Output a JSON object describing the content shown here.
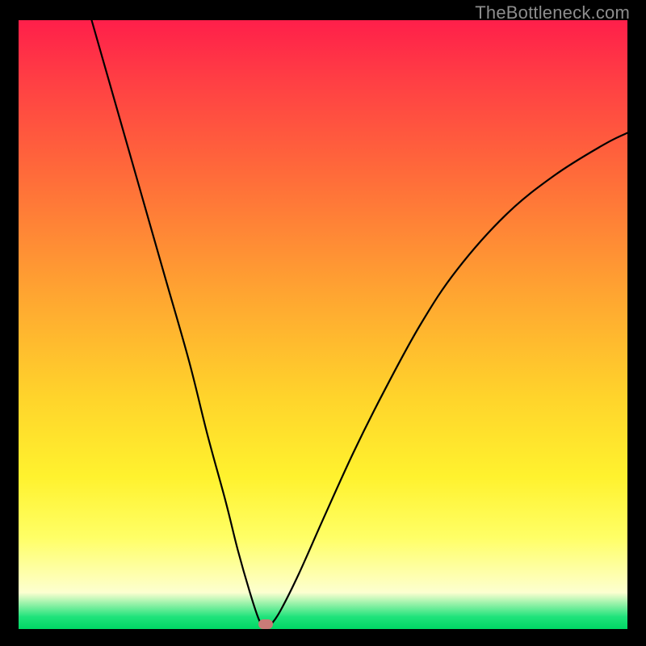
{
  "watermark": "TheBottleneck.com",
  "gradient_colors": {
    "top": "#ff1f4a",
    "mid_upper": "#ff8a36",
    "mid": "#ffe92f",
    "pale": "#fdffd0",
    "bottom": "#00d864"
  },
  "marker": {
    "x_pct": 40.6,
    "y_pct": 99.2,
    "color": "#c97b77"
  },
  "chart_data": {
    "type": "line",
    "title": "",
    "xlabel": "",
    "ylabel": "",
    "xlim": [
      0,
      100
    ],
    "ylim": [
      0,
      100
    ],
    "annotations": [
      "TheBottleneck.com"
    ],
    "series": [
      {
        "name": "bottleneck-curve",
        "x": [
          12.0,
          16.0,
          20.0,
          24.0,
          28.0,
          31.0,
          34.0,
          36.0,
          38.0,
          39.5,
          40.6,
          41.5,
          43.0,
          46.0,
          50.0,
          55.0,
          60.0,
          66.0,
          72.0,
          80.0,
          88.0,
          96.0,
          100.0
        ],
        "y": [
          100.0,
          86.0,
          72.0,
          58.0,
          44.0,
          32.0,
          21.0,
          13.0,
          6.0,
          1.5,
          0.0,
          0.8,
          3.0,
          9.0,
          18.0,
          29.0,
          39.0,
          50.0,
          59.0,
          68.0,
          74.5,
          79.5,
          81.5
        ]
      }
    ],
    "minimum_point": {
      "x": 40.6,
      "y": 0.0
    }
  }
}
